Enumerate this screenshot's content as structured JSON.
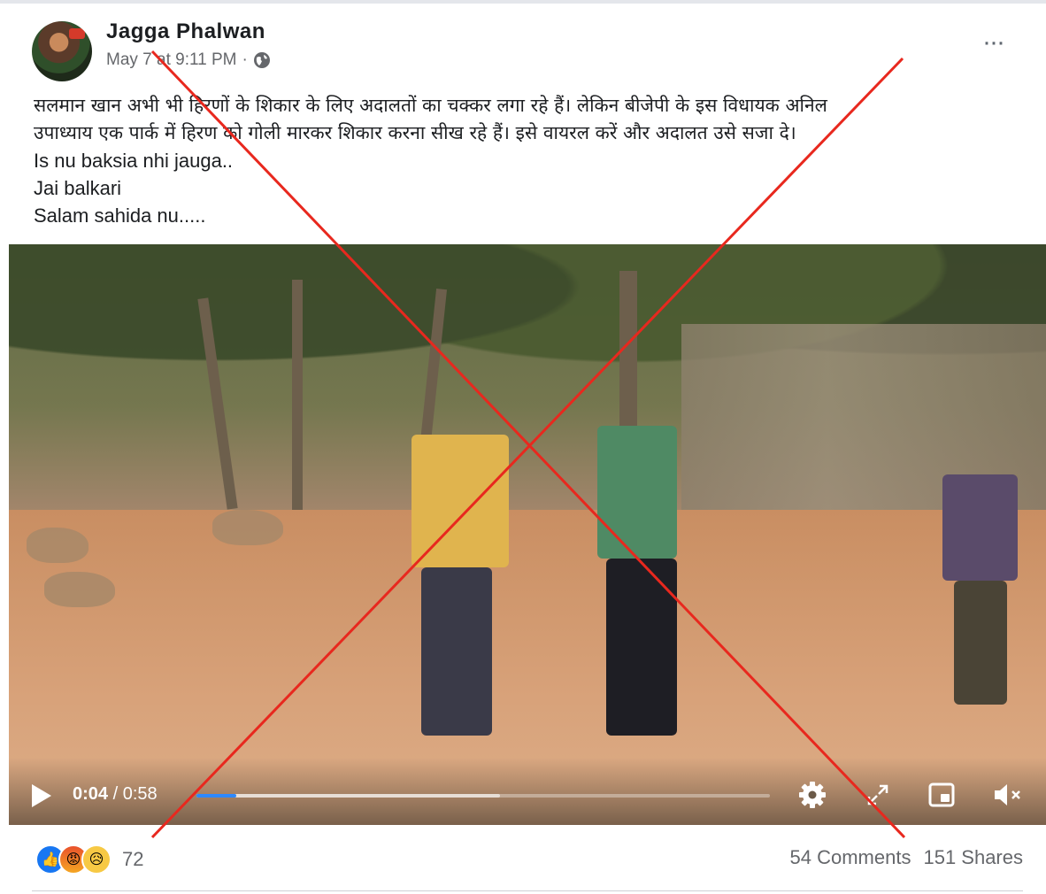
{
  "post": {
    "author": "Jagga Phalwan",
    "date": "May 7 at 9:11 PM",
    "separator": "·",
    "privacy_icon": "globe-icon",
    "more_icon": "more-options-icon",
    "more_label": "···",
    "text_lines": [
      "सलमान खान अभी भी हिरणों के शिकार के लिए अदालतों का चक्कर लगा रहे हैं।  लेकिन बीजेपी के इस विधायक अनिल",
      "उपाध्याय एक पार्क में हिरण को गोली मारकर शिकार करना सीख रहे हैं।  इसे वायरल करें और अदालत उसे सजा दे।",
      "Is nu baksia nhi jauga..",
      "Jai balkari",
      "Salam sahida nu....."
    ]
  },
  "video": {
    "current_time": "0:04",
    "time_separator": "/",
    "duration": "0:58",
    "progress": 0.069,
    "buffered": 0.53,
    "icons": [
      "play-icon",
      "settings-gear-icon",
      "fullscreen-icon",
      "picture-in-picture-icon",
      "volume-muted-icon"
    ],
    "progress_color": "#2d88ff"
  },
  "engagement": {
    "reactions": [
      "like-icon",
      "angry-icon",
      "sad-icon"
    ],
    "reaction_count": "72",
    "comments": "54 Comments",
    "shares": "151 Shares"
  },
  "overlay": {
    "cross_color": "#e8281e"
  }
}
